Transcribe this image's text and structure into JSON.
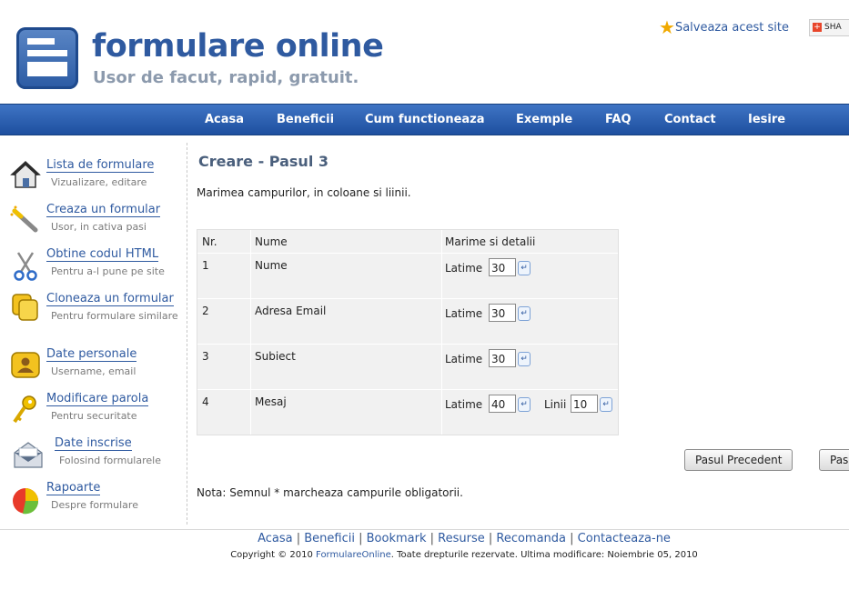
{
  "header": {
    "site_title": "formulare online",
    "tagline": "Usor de facut, rapid, gratuit.",
    "save_site": "Salveaza acest site",
    "share": "SHA"
  },
  "nav": [
    "Acasa",
    "Beneficii",
    "Cum functioneaza",
    "Exemple",
    "FAQ",
    "Contact",
    "Iesire"
  ],
  "sidebar": {
    "items": [
      {
        "title": "Lista de formulare",
        "sub": "Vizualizare, editare",
        "icon": "house-icon"
      },
      {
        "title": "Creaza un formular",
        "sub": "Usor, in cativa pasi",
        "icon": "magic-wand-icon"
      },
      {
        "title": "Obtine codul HTML",
        "sub": "Pentru a-l pune pe site",
        "icon": "scissors-icon"
      },
      {
        "title": "Cloneaza un formular",
        "sub": "Pentru formulare similare",
        "icon": "clone-icon"
      },
      {
        "title": "Date personale",
        "sub": "Username, email",
        "icon": "user-card-icon"
      },
      {
        "title": "Modificare parola",
        "sub": "Pentru securitate",
        "icon": "key-icon"
      },
      {
        "title": "Date inscrise",
        "sub": "Folosind formularele",
        "icon": "envelope-icon"
      },
      {
        "title": "Rapoarte",
        "sub": "Despre formulare",
        "icon": "pie-chart-icon"
      }
    ]
  },
  "main": {
    "title": "Creare - Pasul 3",
    "intro": "Marimea campurilor, in coloane si liinii.",
    "table": {
      "headers": [
        "Nr.",
        "Nume",
        "Marime si detalii"
      ],
      "rows": [
        {
          "nr": "1",
          "name": "Nume",
          "width_label": "Latime",
          "width": "30"
        },
        {
          "nr": "2",
          "name": "Adresa Email",
          "width_label": "Latime",
          "width": "30"
        },
        {
          "nr": "3",
          "name": "Subiect",
          "width_label": "Latime",
          "width": "30"
        },
        {
          "nr": "4",
          "name": "Mesaj",
          "width_label": "Latime",
          "width": "40",
          "lines_label": "Linii",
          "lines": "10"
        }
      ]
    },
    "prev_button": "Pasul Precedent",
    "next_button": "Pas",
    "note": "Nota: Semnul * marcheaza campurile obligatorii."
  },
  "footer": {
    "links": [
      "Acasa",
      "Beneficii",
      "Bookmark",
      "Resurse",
      "Recomanda",
      "Contacteaza-ne"
    ],
    "copy_prefix": "Copyright © 2010",
    "copy_brand": "FormulareOnline",
    "copy_suffix": ". Toate drepturile rezervate. Ultima modificare: Noiembrie 05, 2010"
  }
}
